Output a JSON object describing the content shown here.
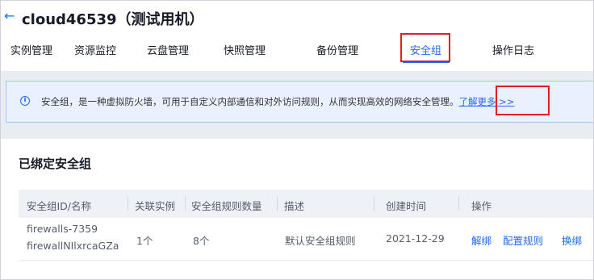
{
  "header": {
    "back_icon": "arrow-left-icon",
    "title": "cloud46539（测试用机）"
  },
  "tabs": [
    {
      "label": "实例管理",
      "active": false
    },
    {
      "label": "资源监控",
      "active": false
    },
    {
      "label": "云盘管理",
      "active": false
    },
    {
      "label": "快照管理",
      "active": false
    },
    {
      "label": "备份管理",
      "active": false
    },
    {
      "label": "安全组",
      "active": true
    },
    {
      "label": "操作日志",
      "active": false
    }
  ],
  "notice": {
    "icon": "info-circle-icon",
    "text": "安全组，是一种虚拟防火墙，可用于自定义内部通信和对外访问规则，从而实现高效的网络安全管理。",
    "link": "了解更多 >>"
  },
  "section": {
    "title": "已绑定安全组"
  },
  "table": {
    "columns": [
      "安全组ID/名称",
      "关联实例",
      "安全组规则数量",
      "描述",
      "创建时间",
      "操作"
    ],
    "rows": [
      {
        "id": "firewalls-7359",
        "name": "firewallNIlxrcaGZa",
        "instances": "1个",
        "rule_count": "8个",
        "description": "默认安全组规则",
        "created": "2021-12-29",
        "actions": [
          "解绑",
          "配置规则",
          "换绑"
        ]
      }
    ]
  },
  "colors": {
    "accent": "#2468f2",
    "highlight_box": "#e02020"
  }
}
